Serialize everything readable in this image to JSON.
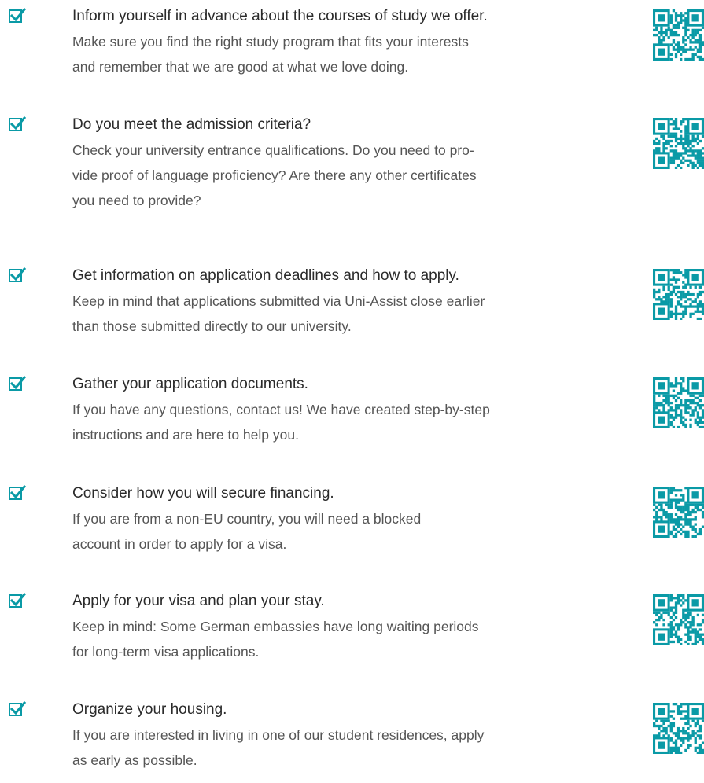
{
  "colors": {
    "accent": "#0a9aa6",
    "title": "#2a2a2a",
    "text": "#555555"
  },
  "checklist": [
    {
      "title": "Inform yourself in advance about the courses of study we offer.",
      "lines": [
        "Make sure you find the right study program that fits your interests",
        "and remember that we are good at what we love doing."
      ]
    },
    {
      "title": "Do you meet the admission criteria?",
      "lines": [
        "Check your university entrance qualifications. Do you need to pro-",
        "vide proof of language proficiency? Are there any other certificates",
        "you need to provide?"
      ]
    },
    {
      "title": "Get information on application deadlines and how to apply.",
      "lines": [
        "Keep in mind that applications submitted via Uni-Assist close earlier",
        "than those submitted directly to our university."
      ]
    },
    {
      "title": "Gather your application documents.",
      "lines": [
        "If you have any questions, contact us! We have created step-by-step",
        "instructions and are here to help you."
      ]
    },
    {
      "title": "Consider how you will secure financing.",
      "lines": [
        "If you are from a non-EU country, you will need a blocked",
        "account in order to apply for a visa."
      ]
    },
    {
      "title": "Apply for your visa and plan your stay.",
      "lines": [
        "Keep in mind: Some German embassies have long waiting periods",
        "for long-term visa applications."
      ]
    },
    {
      "title": "Organize your housing.",
      "lines": [
        "If you are interested in living in one of our student residences, apply",
        "as early as possible."
      ]
    }
  ],
  "icons": {
    "checkbox": "checked-box-icon",
    "qr": "qr-code-icon"
  }
}
